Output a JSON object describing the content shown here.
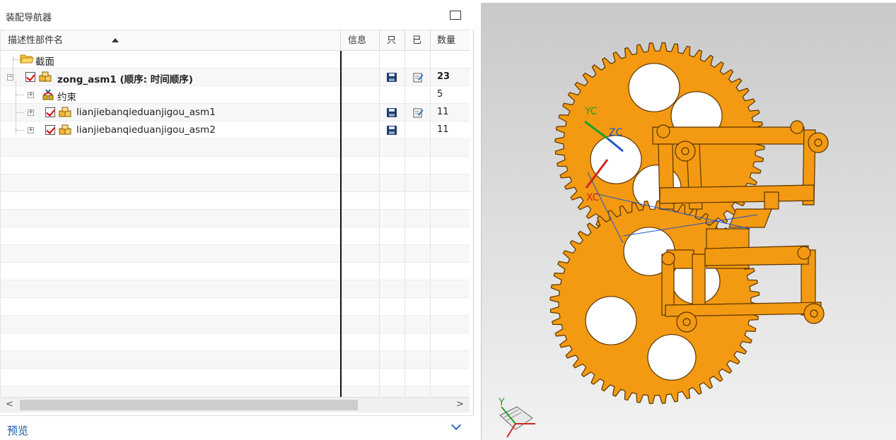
{
  "navigator": {
    "title": "装配导航器",
    "columns": {
      "name": "描述性部件名",
      "info": "信息",
      "readonly": "只",
      "modified": "已",
      "count": "数量"
    },
    "rows": [
      {
        "name": "截面",
        "icon": "folder-icon",
        "count": ""
      },
      {
        "name": "zong_asm1 (顺序: 时间顺序)",
        "icon": "assembly-icon",
        "checked": true,
        "readonly": true,
        "modified": true,
        "count": "23"
      },
      {
        "name": "约束",
        "icon": "constraint-icon",
        "count": "5"
      },
      {
        "name": "lianjiebanqieduanjigou_asm1",
        "icon": "assembly-icon",
        "checked": true,
        "readonly": true,
        "modified": true,
        "count": "11"
      },
      {
        "name": "lianjiebanqieduanjigou_asm2",
        "icon": "assembly-icon",
        "checked": true,
        "readonly": true,
        "modified": false,
        "count": "11"
      }
    ],
    "scroll_left": "<",
    "scroll_right": ">"
  },
  "preview": {
    "label": "预览"
  },
  "viewport": {
    "axis_labels": {
      "yc": "YC",
      "zc": "ZC",
      "xc": "XC",
      "triad_y": "Y"
    },
    "colors": {
      "gear": "#f39a12",
      "gear_stroke": "#5a3400",
      "background_top": "#c9c9c9",
      "background_bottom": "#f2f2f2"
    }
  }
}
